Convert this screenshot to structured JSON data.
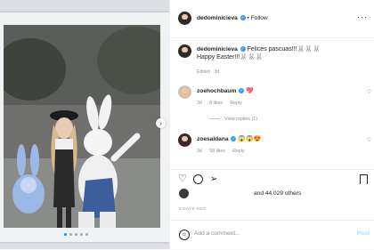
{
  "post": {
    "author": "dedominicieva",
    "follow_label": "Follow",
    "caption": {
      "username": "dedominicieva",
      "line1": "Felices pascuas!!!🐰🐰🐰",
      "line2": "Happy Easter!!!🐰🐰🐰",
      "meta": "Edited · 3d"
    },
    "comments": [
      {
        "username": "zoehochbaum",
        "text": "💖",
        "time": "3d",
        "likes": "8 likes",
        "reply": "Reply",
        "view_replies": "View replies (1)"
      },
      {
        "username": "zoesaldana",
        "text": "😱😱😍",
        "time": "3d",
        "likes": "58 likes",
        "reply": "Reply"
      }
    ],
    "likes_text": "and 44.029 others",
    "date": "3 DAYS AGO",
    "add_comment_placeholder": "Add a comment...",
    "post_button": "Post",
    "carousel": {
      "total": 5,
      "active": 1
    }
  },
  "icons": {
    "more": "more-horizontal-icon",
    "heart": "heart-icon",
    "comment": "comment-icon",
    "share": "share-icon",
    "bookmark": "bookmark-icon",
    "emoji": "emoji-icon",
    "next": "chevron-right-icon"
  },
  "colors": {
    "accent": "#0095f6",
    "verified": "#3897f0",
    "muted": "#8e8e8e"
  }
}
